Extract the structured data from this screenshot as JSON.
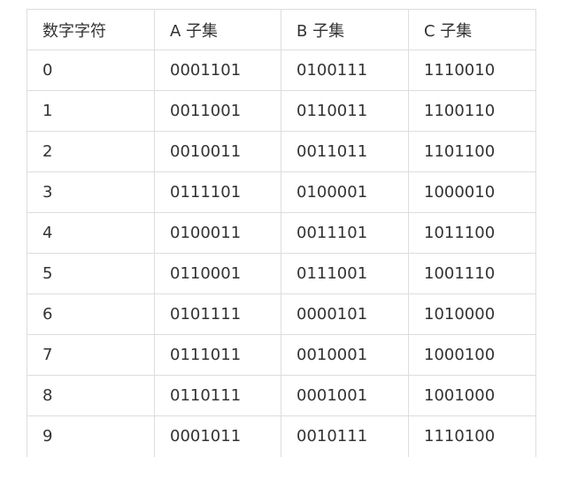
{
  "table": {
    "headers": [
      "数字字符",
      "A 子集",
      "B 子集",
      "C 子集"
    ],
    "rows": [
      [
        "0",
        "0001101",
        "0100111",
        "1110010"
      ],
      [
        "1",
        "0011001",
        "0110011",
        "1100110"
      ],
      [
        "2",
        "0010011",
        "0011011",
        "1101100"
      ],
      [
        "3",
        "0111101",
        "0100001",
        "1000010"
      ],
      [
        "4",
        "0100011",
        "0011101",
        "1011100"
      ],
      [
        "5",
        "0110001",
        "0111001",
        "1001110"
      ],
      [
        "6",
        "0101111",
        "0000101",
        "1010000"
      ],
      [
        "7",
        "0111011",
        "0010001",
        "1000100"
      ],
      [
        "8",
        "0110111",
        "0001001",
        "1001000"
      ],
      [
        "9",
        "0001011",
        "0010111",
        "1110100"
      ]
    ]
  }
}
